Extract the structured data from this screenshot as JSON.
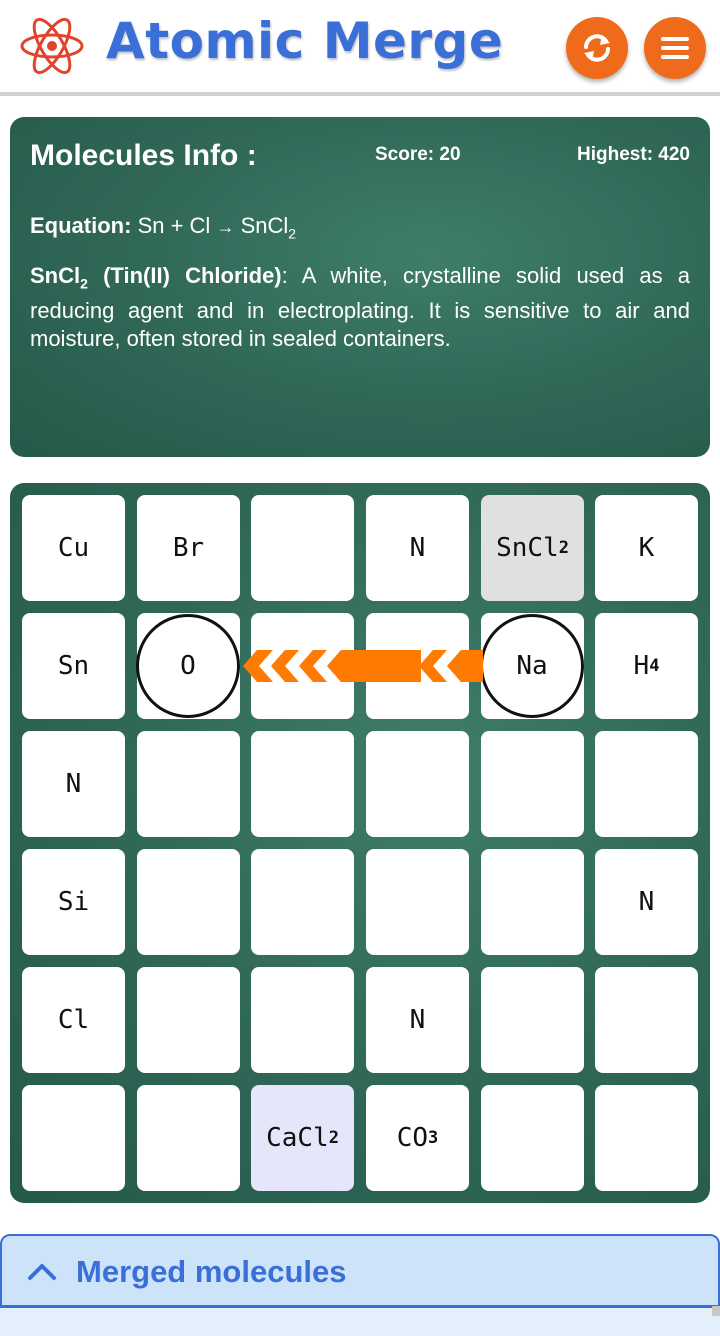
{
  "header": {
    "title": "Atomic Merge",
    "logo_icon": "atom-icon",
    "refresh_icon": "refresh-icon",
    "menu_icon": "hamburger-menu-icon",
    "accent_color": "#f06a1c",
    "title_color": "#3a6fd8"
  },
  "info": {
    "title": "Molecules Info :",
    "score": "Score: 20",
    "highest": "Highest: 420",
    "equation_label": "Equation:",
    "equation_lhs": "Sn + Cl",
    "equation_arrow": "→",
    "equation_rhs_base": "SnCl",
    "equation_rhs_sub": "2",
    "desc_name_base": "SnCl",
    "desc_name_sub": "2",
    "desc_name_rest": " (Tin(II) Chloride)",
    "desc_text": ": A white, crystalline solid used as a reducing agent and in electroplating. It is sensitive to air and moisture, often stored in sealed containers."
  },
  "board": {
    "rows": [
      [
        {
          "base": "Cu"
        },
        {
          "base": "Br"
        },
        {
          "base": ""
        },
        {
          "base": "N"
        },
        {
          "base": "SnCl",
          "sub": "2",
          "state": "selected"
        },
        {
          "base": "K"
        }
      ],
      [
        {
          "base": "Sn"
        },
        {
          "base": "O",
          "state": "ringed"
        },
        {
          "base": ""
        },
        {
          "base": ""
        },
        {
          "base": "Na",
          "state": "ringed"
        },
        {
          "base": "H",
          "sub": "4"
        }
      ],
      [
        {
          "base": "N"
        },
        {
          "base": ""
        },
        {
          "base": ""
        },
        {
          "base": ""
        },
        {
          "base": ""
        },
        {
          "base": ""
        }
      ],
      [
        {
          "base": "Si"
        },
        {
          "base": ""
        },
        {
          "base": ""
        },
        {
          "base": ""
        },
        {
          "base": ""
        },
        {
          "base": "N"
        }
      ],
      [
        {
          "base": "Cl"
        },
        {
          "base": ""
        },
        {
          "base": ""
        },
        {
          "base": "N"
        },
        {
          "base": ""
        },
        {
          "base": ""
        }
      ],
      [
        {
          "base": ""
        },
        {
          "base": ""
        },
        {
          "base": "CaCl",
          "sub": "2",
          "state": "highlight"
        },
        {
          "base": "CO",
          "sub": "3"
        },
        {
          "base": ""
        },
        {
          "base": ""
        }
      ]
    ],
    "move_arrow_icon": "left-arrow-icon"
  },
  "merged": {
    "label": "Merged molecules",
    "toggle_icon": "chevron-up-icon"
  }
}
